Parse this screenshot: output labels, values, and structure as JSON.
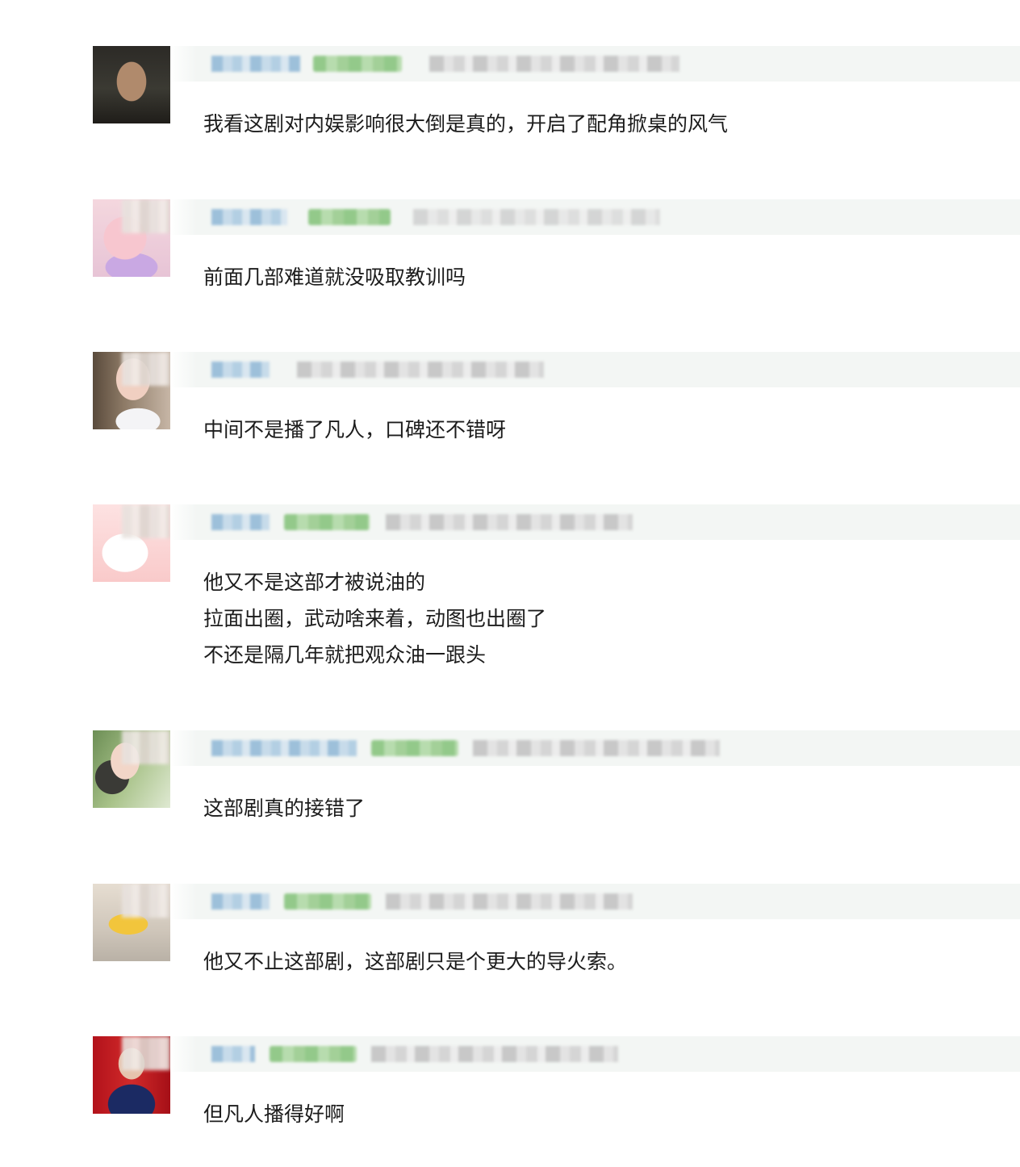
{
  "comments": [
    {
      "avatar_icon": "user-avatar",
      "name_hint": "",
      "time_hint": "",
      "text": "我看这剧对内娱影响很大倒是真的，开启了配角掀桌的风气"
    },
    {
      "avatar_icon": "user-avatar",
      "name_hint": "",
      "time_hint": "",
      "text": "前面几部难道就没吸取教训吗"
    },
    {
      "avatar_icon": "user-avatar",
      "name_hint": "",
      "time_hint": "",
      "text": "中间不是播了凡人，口碑还不错呀"
    },
    {
      "avatar_icon": "user-avatar",
      "name_hint": "",
      "time_hint": "",
      "text": "他又不是这部才被说油的\n拉面出圈，武动啥来着，动图也出圈了\n不还是隔几年就把观众油一跟头"
    },
    {
      "avatar_icon": "user-avatar",
      "name_hint": "",
      "time_hint": "",
      "text": "这部剧真的接错了"
    },
    {
      "avatar_icon": "user-avatar",
      "name_hint": "",
      "time_hint": "",
      "text": "他又不止这部剧，这部剧只是个更大的导火索。"
    },
    {
      "avatar_icon": "user-avatar",
      "name_hint": "",
      "time_hint": "",
      "text": "但凡人播得好啊"
    }
  ],
  "colors": {
    "meta_band": "#f3f6f4",
    "name_blur": "#9dc0da",
    "badge_blur": "#93c98a",
    "time_blur": "#c8c8c8",
    "text": "#1c1c1c"
  }
}
